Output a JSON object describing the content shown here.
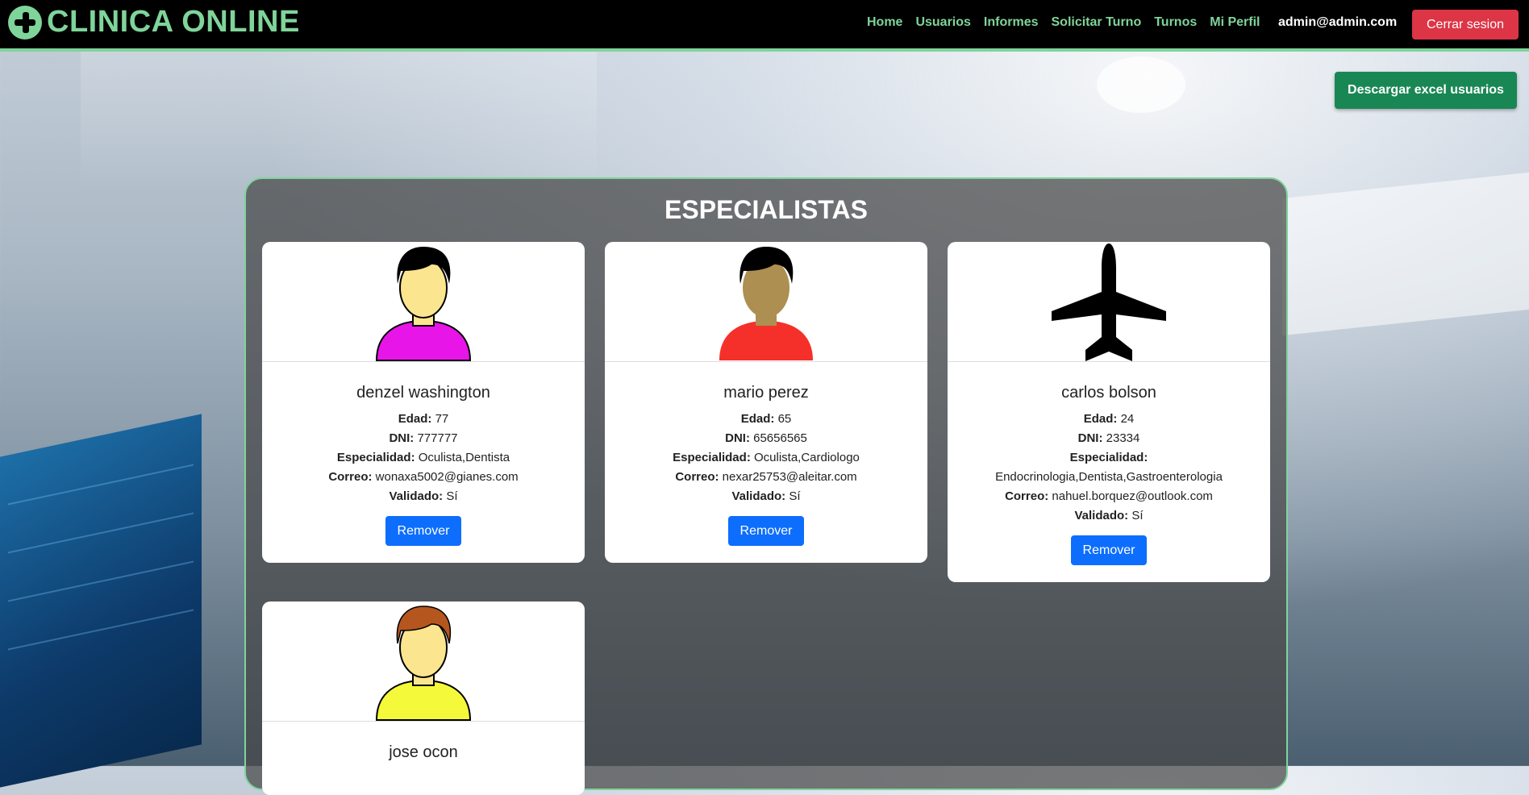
{
  "navbar": {
    "brand": "CLINICA ONLINE",
    "links": [
      "Home",
      "Usuarios",
      "Informes",
      "Solicitar Turno",
      "Turnos",
      "Mi Perfil"
    ],
    "user_email": "admin@admin.com",
    "logout_label": "Cerrar sesion"
  },
  "actions": {
    "excel_label": "Descargar excel usuarios"
  },
  "section": {
    "title": "ESPECIALISTAS"
  },
  "labels": {
    "edad": "Edad:",
    "dni": "DNI:",
    "especialidad": "Especialidad:",
    "correo": "Correo:",
    "validado": "Validado:",
    "remove": "Remover"
  },
  "specialists": [
    {
      "name": "denzel washington",
      "edad": "77",
      "dni": "777777",
      "especialidad": "Oculista,Dentista",
      "correo": "wonaxa5002@gianes.com",
      "validado": "Sí",
      "avatar": "person-icon",
      "shirt_color": "#e815e8",
      "skin_color": "#fce58f",
      "hair_color": "#000000"
    },
    {
      "name": "mario perez",
      "edad": "65",
      "dni": "65656565",
      "especialidad": "Oculista,Cardiologo",
      "correo": "nexar25753@aleitar.com",
      "validado": "Sí",
      "avatar": "person-icon",
      "shirt_color": "#f5302a",
      "skin_color": "#ad8f52",
      "hair_color": "#000000"
    },
    {
      "name": "carlos bolson",
      "edad": "24",
      "dni": "23334",
      "especialidad": "Endocrinologia,Dentista,Gastroenterologia",
      "correo": "nahuel.borquez@outlook.com",
      "validado": "Sí",
      "avatar": "airplane-icon"
    },
    {
      "name": "jose ocon",
      "avatar": "person-icon",
      "shirt_color": "#f4f93a",
      "skin_color": "#fce58f",
      "hair_color": "#b5561f"
    }
  ]
}
